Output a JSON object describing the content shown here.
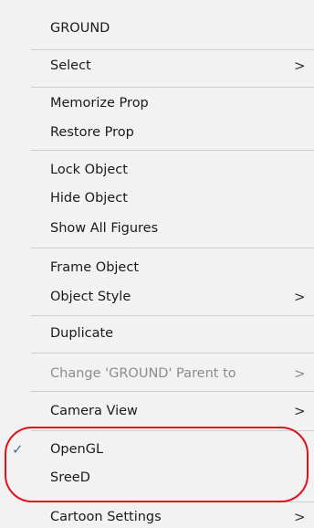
{
  "menu": {
    "items": [
      {
        "label": "GROUND"
      },
      {
        "label": "Select",
        "submenu": true
      },
      {
        "label": "Memorize Prop"
      },
      {
        "label": "Restore Prop"
      },
      {
        "label": "Lock Object"
      },
      {
        "label": "Hide Object"
      },
      {
        "label": "Show All Figures"
      },
      {
        "label": "Frame Object"
      },
      {
        "label": "Object Style",
        "submenu": true
      },
      {
        "label": "Duplicate"
      },
      {
        "label": "Change 'GROUND' Parent to",
        "submenu": true,
        "disabled": true
      },
      {
        "label": "Camera View",
        "submenu": true
      },
      {
        "label": "OpenGL",
        "checked": true
      },
      {
        "label": "SreeD"
      },
      {
        "label": "Cartoon Settings",
        "submenu": true
      }
    ],
    "submenu_arrow": ">",
    "check_mark": "✓"
  },
  "colors": {
    "menu_background": "#f2f2f2",
    "separator": "#cfcfcf",
    "disabled_text": "#8c8c8c",
    "check": "#3a6ea5",
    "highlight_outline": "#e0111b"
  },
  "icons": [
    "check-icon",
    "chevron-right-icon"
  ]
}
